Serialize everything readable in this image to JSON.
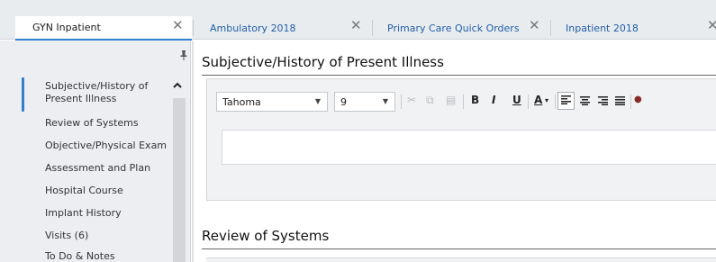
{
  "tabs": [
    {
      "label": "GYN Inpatient",
      "close": "✕",
      "active": true
    },
    {
      "label": "Ambulatory 2018",
      "close": "✕",
      "active": false
    },
    {
      "label": "Primary Care Quick Orders",
      "close": "✕",
      "active": false
    },
    {
      "label": "Inpatient 2018",
      "close": "✕",
      "active": false
    }
  ],
  "sidebar": {
    "pin_icon": "pin-icon",
    "collapse_icon": "caret-up-icon",
    "items": [
      {
        "label": "Subjective/History of Present Illness",
        "selected": true
      },
      {
        "label": "Review of Systems"
      },
      {
        "label": "Objective/Physical Exam"
      },
      {
        "label": "Assessment and Plan"
      },
      {
        "label": "Hospital Course"
      },
      {
        "label": "Implant History"
      },
      {
        "label": "Visits (6)"
      },
      {
        "label": "To Do & Notes"
      }
    ]
  },
  "main": {
    "sections": [
      {
        "title": "Subjective/History of Present Illness"
      },
      {
        "title": "Review of Systems"
      }
    ],
    "toolbar": {
      "font_family": "Tahoma",
      "font_size": "9",
      "bold": "B",
      "italic": "I",
      "underline": "U",
      "font_color": "A"
    },
    "editor_text": ""
  },
  "colors": {
    "accent": "#2f80d0",
    "tab_link": "#1f5ea8",
    "sidebar_bg": "#eceef1"
  }
}
